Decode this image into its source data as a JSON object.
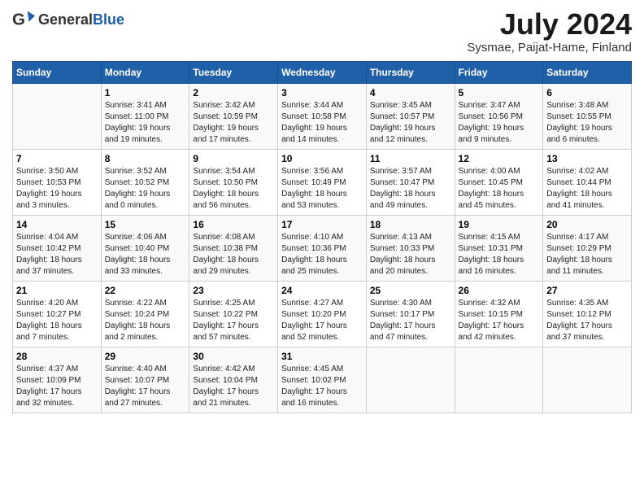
{
  "header": {
    "logo_general": "General",
    "logo_blue": "Blue",
    "title": "July 2024",
    "subtitle": "Sysmae, Paijat-Hame, Finland"
  },
  "days_of_week": [
    "Sunday",
    "Monday",
    "Tuesday",
    "Wednesday",
    "Thursday",
    "Friday",
    "Saturday"
  ],
  "weeks": [
    [
      {
        "day": "",
        "info": ""
      },
      {
        "day": "1",
        "info": "Sunrise: 3:41 AM\nSunset: 11:00 PM\nDaylight: 19 hours\nand 19 minutes."
      },
      {
        "day": "2",
        "info": "Sunrise: 3:42 AM\nSunset: 10:59 PM\nDaylight: 19 hours\nand 17 minutes."
      },
      {
        "day": "3",
        "info": "Sunrise: 3:44 AM\nSunset: 10:58 PM\nDaylight: 19 hours\nand 14 minutes."
      },
      {
        "day": "4",
        "info": "Sunrise: 3:45 AM\nSunset: 10:57 PM\nDaylight: 19 hours\nand 12 minutes."
      },
      {
        "day": "5",
        "info": "Sunrise: 3:47 AM\nSunset: 10:56 PM\nDaylight: 19 hours\nand 9 minutes."
      },
      {
        "day": "6",
        "info": "Sunrise: 3:48 AM\nSunset: 10:55 PM\nDaylight: 19 hours\nand 6 minutes."
      }
    ],
    [
      {
        "day": "7",
        "info": "Sunrise: 3:50 AM\nSunset: 10:53 PM\nDaylight: 19 hours\nand 3 minutes."
      },
      {
        "day": "8",
        "info": "Sunrise: 3:52 AM\nSunset: 10:52 PM\nDaylight: 19 hours\nand 0 minutes."
      },
      {
        "day": "9",
        "info": "Sunrise: 3:54 AM\nSunset: 10:50 PM\nDaylight: 18 hours\nand 56 minutes."
      },
      {
        "day": "10",
        "info": "Sunrise: 3:56 AM\nSunset: 10:49 PM\nDaylight: 18 hours\nand 53 minutes."
      },
      {
        "day": "11",
        "info": "Sunrise: 3:57 AM\nSunset: 10:47 PM\nDaylight: 18 hours\nand 49 minutes."
      },
      {
        "day": "12",
        "info": "Sunrise: 4:00 AM\nSunset: 10:45 PM\nDaylight: 18 hours\nand 45 minutes."
      },
      {
        "day": "13",
        "info": "Sunrise: 4:02 AM\nSunset: 10:44 PM\nDaylight: 18 hours\nand 41 minutes."
      }
    ],
    [
      {
        "day": "14",
        "info": "Sunrise: 4:04 AM\nSunset: 10:42 PM\nDaylight: 18 hours\nand 37 minutes."
      },
      {
        "day": "15",
        "info": "Sunrise: 4:06 AM\nSunset: 10:40 PM\nDaylight: 18 hours\nand 33 minutes."
      },
      {
        "day": "16",
        "info": "Sunrise: 4:08 AM\nSunset: 10:38 PM\nDaylight: 18 hours\nand 29 minutes."
      },
      {
        "day": "17",
        "info": "Sunrise: 4:10 AM\nSunset: 10:36 PM\nDaylight: 18 hours\nand 25 minutes."
      },
      {
        "day": "18",
        "info": "Sunrise: 4:13 AM\nSunset: 10:33 PM\nDaylight: 18 hours\nand 20 minutes."
      },
      {
        "day": "19",
        "info": "Sunrise: 4:15 AM\nSunset: 10:31 PM\nDaylight: 18 hours\nand 16 minutes."
      },
      {
        "day": "20",
        "info": "Sunrise: 4:17 AM\nSunset: 10:29 PM\nDaylight: 18 hours\nand 11 minutes."
      }
    ],
    [
      {
        "day": "21",
        "info": "Sunrise: 4:20 AM\nSunset: 10:27 PM\nDaylight: 18 hours\nand 7 minutes."
      },
      {
        "day": "22",
        "info": "Sunrise: 4:22 AM\nSunset: 10:24 PM\nDaylight: 18 hours\nand 2 minutes."
      },
      {
        "day": "23",
        "info": "Sunrise: 4:25 AM\nSunset: 10:22 PM\nDaylight: 17 hours\nand 57 minutes."
      },
      {
        "day": "24",
        "info": "Sunrise: 4:27 AM\nSunset: 10:20 PM\nDaylight: 17 hours\nand 52 minutes."
      },
      {
        "day": "25",
        "info": "Sunrise: 4:30 AM\nSunset: 10:17 PM\nDaylight: 17 hours\nand 47 minutes."
      },
      {
        "day": "26",
        "info": "Sunrise: 4:32 AM\nSunset: 10:15 PM\nDaylight: 17 hours\nand 42 minutes."
      },
      {
        "day": "27",
        "info": "Sunrise: 4:35 AM\nSunset: 10:12 PM\nDaylight: 17 hours\nand 37 minutes."
      }
    ],
    [
      {
        "day": "28",
        "info": "Sunrise: 4:37 AM\nSunset: 10:09 PM\nDaylight: 17 hours\nand 32 minutes."
      },
      {
        "day": "29",
        "info": "Sunrise: 4:40 AM\nSunset: 10:07 PM\nDaylight: 17 hours\nand 27 minutes."
      },
      {
        "day": "30",
        "info": "Sunrise: 4:42 AM\nSunset: 10:04 PM\nDaylight: 17 hours\nand 21 minutes."
      },
      {
        "day": "31",
        "info": "Sunrise: 4:45 AM\nSunset: 10:02 PM\nDaylight: 17 hours\nand 16 minutes."
      },
      {
        "day": "",
        "info": ""
      },
      {
        "day": "",
        "info": ""
      },
      {
        "day": "",
        "info": ""
      }
    ]
  ]
}
